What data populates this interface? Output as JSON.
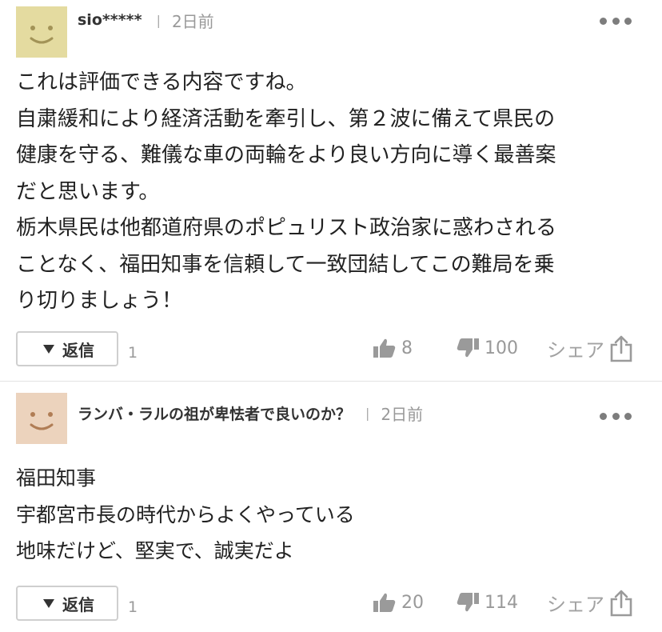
{
  "comments": [
    {
      "username": "sio*****",
      "separator": "|",
      "time": "2日前",
      "avatar_color": "#e4dba0",
      "lines": [
        "これは評価できる内容ですね。",
        "自粛緩和により経済活動を牽引し、第２波に備えて県民の",
        "健康を守る、難儀な車の両輪をより良い方向に導く最善案",
        "だと思います。",
        "栃木県民は他都道府県のポピュリスト政治家に惑わされる",
        "ことなく、福田知事を信頼して一致団結してこの難局を乗",
        "り切りましょう！"
      ],
      "reply_label": "返信",
      "reply_count": "1",
      "likes": "8",
      "dislikes": "100",
      "share_label": "シェア"
    },
    {
      "username": "ランバ・ラルの祖が卑怯者で良いのか？",
      "separator": "|",
      "time": "2日前",
      "avatar_color": "#ecd3bd",
      "lines": [
        "福田知事",
        "宇都宮市長の時代からよくやっている",
        "地味だけど、堅実で、誠実だよ"
      ],
      "reply_label": "返信",
      "reply_count": "1",
      "likes": "20",
      "dislikes": "114",
      "share_label": "シェア"
    }
  ],
  "colors": {
    "text": "#222222",
    "muted": "#999999",
    "border": "#cfcfcf",
    "icon": "#999999"
  },
  "icons": {
    "like": "thumbs-up-icon",
    "dislike": "thumbs-down-icon",
    "share": "share-icon",
    "more": "more-dots-icon",
    "reply": "triangle-down-icon"
  }
}
